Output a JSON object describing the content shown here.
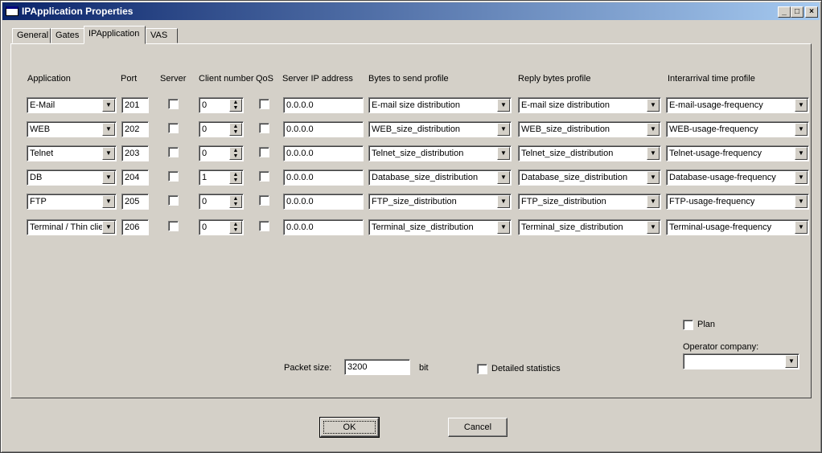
{
  "window": {
    "title": "IPApplication Properties",
    "minimize_glyph": "_",
    "maximize_glyph": "□",
    "close_glyph": "×"
  },
  "tabs": [
    "General",
    "Gates",
    "IPApplication",
    "VAS"
  ],
  "active_tab": "IPApplication",
  "columns": [
    "Application",
    "Port",
    "Server",
    "Client number",
    "QoS",
    "Server IP address",
    "Bytes to send profile",
    "Reply bytes profile",
    "Interarrival time profile"
  ],
  "rows": [
    {
      "application": "E-Mail",
      "port": "201",
      "server": false,
      "client_number": "0",
      "qos": false,
      "server_ip": "0.0.0.0",
      "bytes_profile": "E-mail size distribution",
      "reply_profile": "E-mail size distribution",
      "interarrival_profile": "E-mail-usage-frequency"
    },
    {
      "application": "WEB",
      "port": "202",
      "server": false,
      "client_number": "0",
      "qos": false,
      "server_ip": "0.0.0.0",
      "bytes_profile": "WEB_size_distribution",
      "reply_profile": "WEB_size_distribution",
      "interarrival_profile": "WEB-usage-frequency"
    },
    {
      "application": "Telnet",
      "port": "203",
      "server": false,
      "client_number": "0",
      "qos": false,
      "server_ip": "0.0.0.0",
      "bytes_profile": "Telnet_size_distribution",
      "reply_profile": "Telnet_size_distribution",
      "interarrival_profile": "Telnet-usage-frequency"
    },
    {
      "application": "DB",
      "port": "204",
      "server": false,
      "client_number": "1",
      "qos": false,
      "server_ip": "0.0.0.0",
      "bytes_profile": "Database_size_distribution",
      "reply_profile": "Database_size_distribution",
      "interarrival_profile": "Database-usage-frequency"
    },
    {
      "application": "FTP",
      "port": "205",
      "server": false,
      "client_number": "0",
      "qos": false,
      "server_ip": "0.0.0.0",
      "bytes_profile": "FTP_size_distribution",
      "reply_profile": "FTP_size_distribution",
      "interarrival_profile": "FTP-usage-frequency"
    },
    {
      "application": "Terminal / Thin clie",
      "port": "206",
      "server": false,
      "client_number": "0",
      "qos": false,
      "server_ip": "0.0.0.0",
      "bytes_profile": "Terminal_size_distribution",
      "reply_profile": "Terminal_size_distribution",
      "interarrival_profile": "Terminal-usage-frequency"
    }
  ],
  "plan": {
    "label": "Plan",
    "checked": false
  },
  "operator_company": {
    "label": "Operator company:",
    "value": ""
  },
  "packet_size": {
    "label": "Packet size:",
    "value": "3200",
    "unit": "bit"
  },
  "detailed_statistics": {
    "label": "Detailed statistics",
    "checked": false
  },
  "buttons": {
    "ok": "OK",
    "cancel": "Cancel"
  },
  "icons": {
    "dropdown": "triangle-down-icon",
    "spin": "spin-arrows-icon"
  }
}
